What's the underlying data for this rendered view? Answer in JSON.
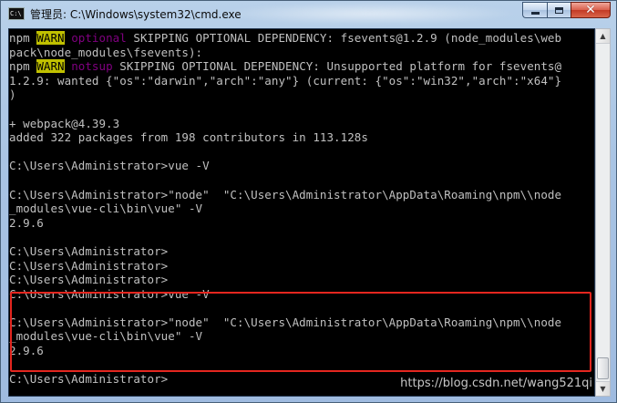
{
  "window": {
    "title": "管理员: C:\\Windows\\system32\\cmd.exe",
    "icon": "cmd-window-icon",
    "icon_text": "C:\\"
  },
  "controls": {
    "minimize": "minimize",
    "maximize": "maximize",
    "close": "close"
  },
  "console": {
    "lines": [
      {
        "parts": [
          {
            "t": "npm "
          },
          {
            "t": "WARN",
            "c": "warn"
          },
          {
            "t": " "
          },
          {
            "t": "optional",
            "c": "tag"
          },
          {
            "t": " SKIPPING OPTIONAL DEPENDENCY: fsevents@1.2.9 (node_modules\\web"
          }
        ]
      },
      {
        "parts": [
          {
            "t": "pack\\node_modules\\fsevents):"
          }
        ]
      },
      {
        "parts": [
          {
            "t": "npm "
          },
          {
            "t": "WARN",
            "c": "warn"
          },
          {
            "t": " "
          },
          {
            "t": "notsup",
            "c": "tag"
          },
          {
            "t": " SKIPPING OPTIONAL DEPENDENCY: Unsupported platform for fsevents@"
          }
        ]
      },
      {
        "parts": [
          {
            "t": "1.2.9: wanted {\"os\":\"darwin\",\"arch\":\"any\"} (current: {\"os\":\"win32\",\"arch\":\"x64\"}"
          }
        ]
      },
      {
        "parts": [
          {
            "t": ")"
          }
        ]
      },
      {
        "parts": [
          {
            "t": ""
          }
        ]
      },
      {
        "parts": [
          {
            "t": "+ webpack@4.39.3"
          }
        ]
      },
      {
        "parts": [
          {
            "t": "added 322 packages from 198 contributors in 113.128s"
          }
        ]
      },
      {
        "parts": [
          {
            "t": ""
          }
        ]
      },
      {
        "parts": [
          {
            "t": "C:\\Users\\Administrator>vue -V"
          }
        ]
      },
      {
        "parts": [
          {
            "t": ""
          }
        ]
      },
      {
        "parts": [
          {
            "t": "C:\\Users\\Administrator>\"node\"  \"C:\\Users\\Administrator\\AppData\\Roaming\\npm\\\\node"
          }
        ]
      },
      {
        "parts": [
          {
            "t": "_modules\\vue-cli\\bin\\vue\" -V"
          }
        ]
      },
      {
        "parts": [
          {
            "t": "2.9.6"
          }
        ]
      },
      {
        "parts": [
          {
            "t": ""
          }
        ]
      },
      {
        "parts": [
          {
            "t": "C:\\Users\\Administrator>"
          }
        ]
      },
      {
        "parts": [
          {
            "t": "C:\\Users\\Administrator>"
          }
        ]
      },
      {
        "parts": [
          {
            "t": "C:\\Users\\Administrator>"
          }
        ]
      },
      {
        "parts": [
          {
            "t": "C:\\Users\\Administrator>vue -V"
          }
        ]
      },
      {
        "parts": [
          {
            "t": ""
          }
        ]
      },
      {
        "parts": [
          {
            "t": "C:\\Users\\Administrator>\"node\"  \"C:\\Users\\Administrator\\AppData\\Roaming\\npm\\\\node"
          }
        ]
      },
      {
        "parts": [
          {
            "t": "_modules\\vue-cli\\bin\\vue\" -V"
          }
        ]
      },
      {
        "parts": [
          {
            "t": "2.9.6"
          }
        ]
      },
      {
        "parts": [
          {
            "t": ""
          }
        ]
      },
      {
        "parts": [
          {
            "t": "C:\\Users\\Administrator>"
          }
        ]
      }
    ],
    "watermark": "https://blog.csdn.net/wang521qi"
  },
  "colors": {
    "console_bg": "#000000",
    "console_fg": "#c0c0c0",
    "warn_bg": "#c0c000",
    "tag": "#800080",
    "highlight": "#e4261f"
  },
  "icons": {
    "scroll_up": "scroll-up-arrow-icon",
    "scroll_down": "scroll-down-arrow-icon"
  }
}
